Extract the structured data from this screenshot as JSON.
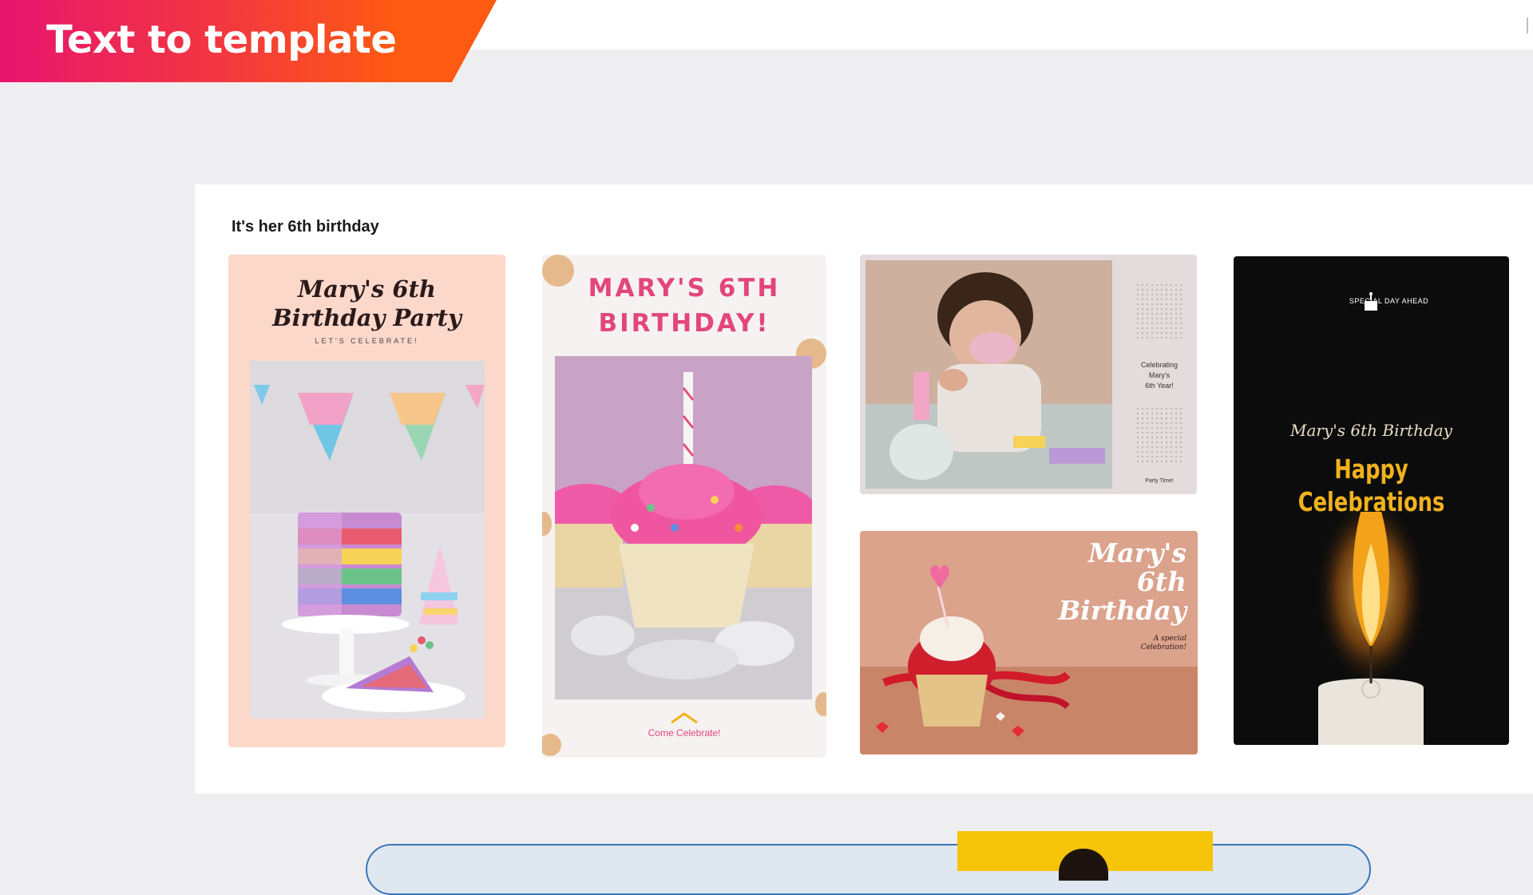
{
  "banner": {
    "title": "Text to template"
  },
  "prompt": {
    "text": "It's her 6th birthday"
  },
  "templates": [
    {
      "title_line1": "Mary's 6th",
      "title_line2": "Birthday Party",
      "subtitle": "LET'S CELEBRATE!"
    },
    {
      "title_line1": "MARY'S 6TH",
      "title_line2": "BIRTHDAY!",
      "footer": "Come Celebrate!"
    },
    {
      "side_line1": "Celebrating",
      "side_line2": "Mary's",
      "side_line3": "6th Year!",
      "side_bottom": "Party Time!"
    },
    {
      "title_line1": "Mary's",
      "title_line2": "6th",
      "title_line3": "Birthday",
      "small_line1": "A special",
      "small_line2": "Celebration!"
    },
    {
      "tag": "SPECIAL DAY AHEAD",
      "script": "Mary's 6th Birthday",
      "headline_line1": "Happy",
      "headline_line2": "Celebrations"
    }
  ],
  "colors": {
    "banner_start": "#e8156e",
    "banner_end": "#ff5a12",
    "pink_text": "#e2467c",
    "gold_text": "#f2b21e"
  }
}
